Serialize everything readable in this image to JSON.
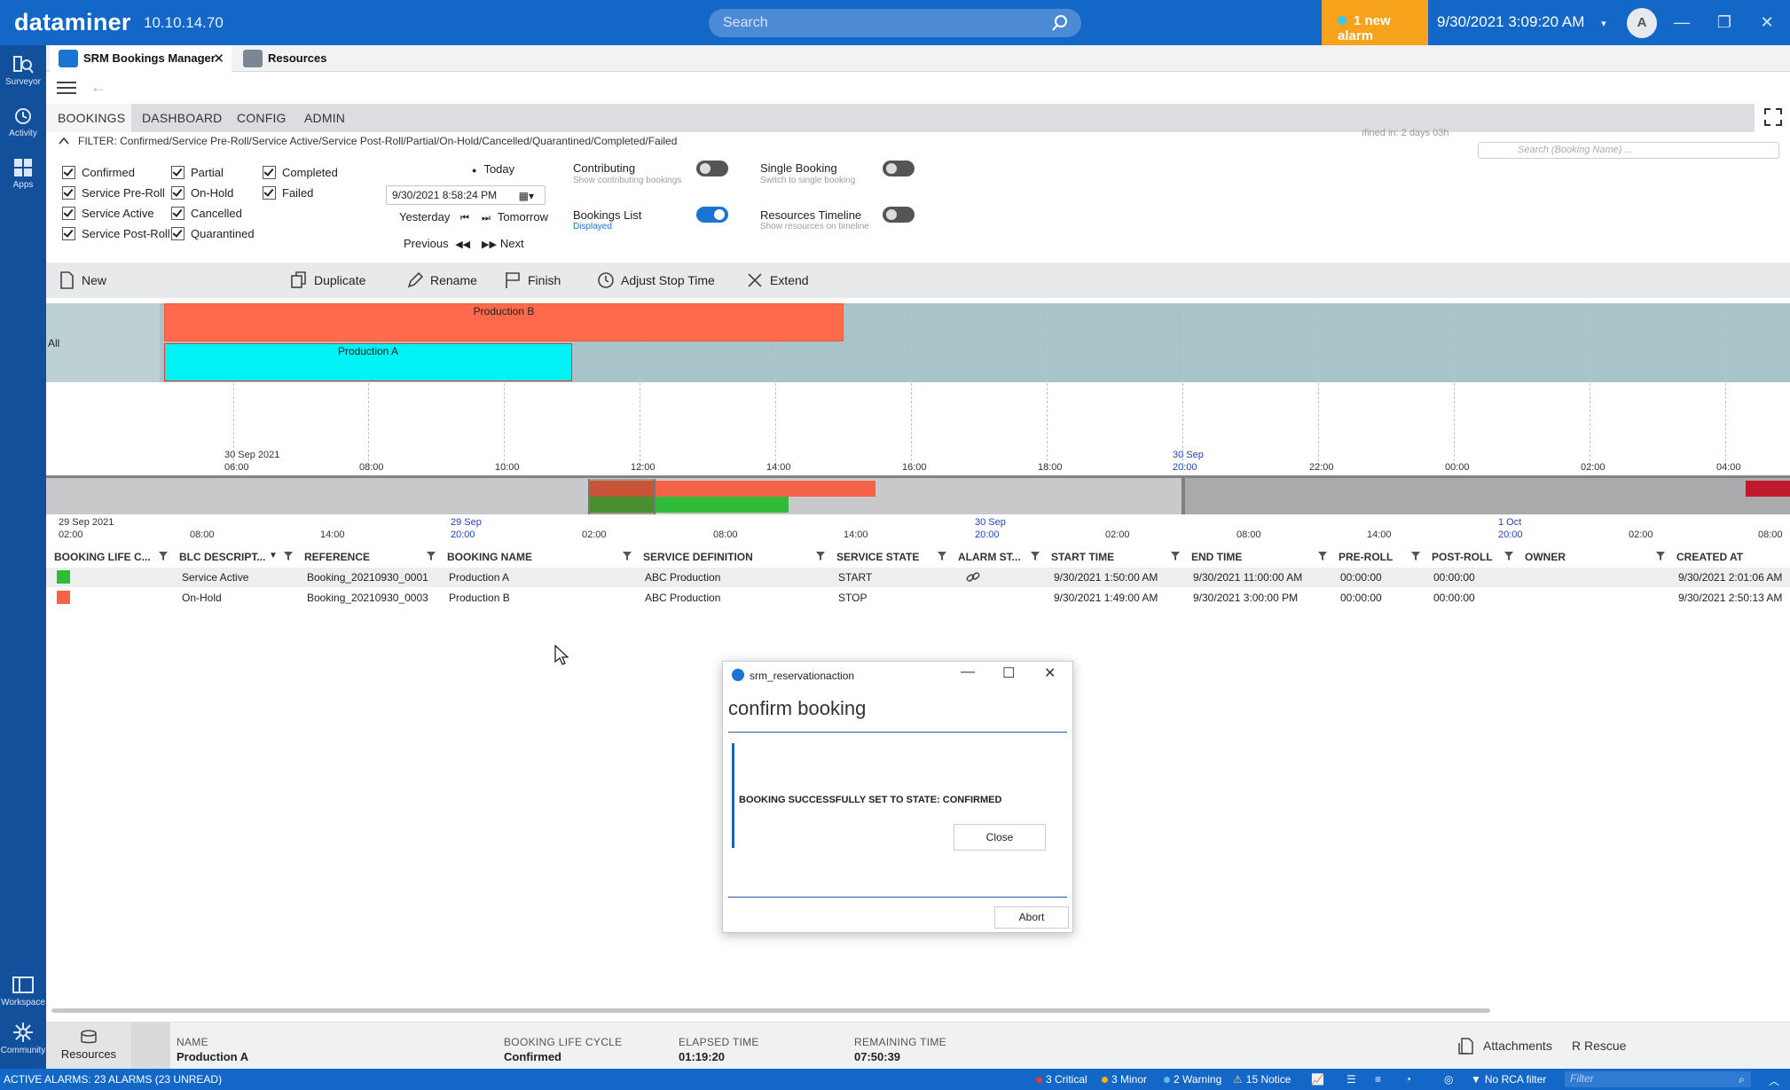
{
  "app": {
    "logo": "dataminer",
    "version": "10.10.14.70",
    "search_placeholder": "Search",
    "alarm_label": "1 new alarm",
    "datetime": "9/30/2021 3:09:20 AM",
    "avatar_initial": "A"
  },
  "rail": [
    {
      "label": "Surveyor",
      "icon": "surveyor-icon"
    },
    {
      "label": "Activity",
      "icon": "history-icon"
    },
    {
      "label": "Apps",
      "icon": "apps-grid-icon"
    },
    {
      "label": "Workspace",
      "icon": "workspace-icon"
    },
    {
      "label": "Community",
      "icon": "community-icon"
    }
  ],
  "tabs": [
    {
      "label": "SRM Bookings Manager",
      "active": true
    },
    {
      "label": "Resources",
      "active": false
    }
  ],
  "subtabs": [
    "BOOKINGS",
    "DASHBOARD",
    "CONFIG",
    "ADMIN"
  ],
  "filter_text": "FILTER: Confirmed/Service Pre-Roll/Service Active/Service Post-Roll/Partial/On-Hold/Cancelled/Quarantined/Completed/Failed",
  "defined_in": "ıfined in: 2 days 03h",
  "booking_search_placeholder": "Search (Booking Name) ...",
  "checkboxes": {
    "col1": [
      "Confirmed",
      "Service Pre-Roll",
      "Service Active",
      "Service Post-Roll"
    ],
    "col2": [
      "Partial",
      "On-Hold",
      "Cancelled",
      "Quarantined"
    ],
    "col3": [
      "Completed",
      "Failed"
    ]
  },
  "date_nav": {
    "today": "Today",
    "date_value": "9/30/2021 8:58:24 PM",
    "yesterday": "Yesterday",
    "tomorrow": "Tomorrow",
    "previous": "Previous",
    "next": "Next"
  },
  "toggles": {
    "contributing": {
      "label": "Contributing",
      "sub": "Show contributing bookings",
      "on": false
    },
    "bookings_list": {
      "label": "Bookings List",
      "sub": "Displayed",
      "on": true
    },
    "single_booking": {
      "label": "Single Booking",
      "sub": "Switch to single booking",
      "on": false
    },
    "resources_timeline": {
      "label": "Resources Timeline",
      "sub": "Show resources on timeline",
      "on": false
    }
  },
  "toolbar": {
    "new": "New",
    "duplicate": "Duplicate",
    "rename": "Rename",
    "finish": "Finish",
    "adjust": "Adjust Stop Time",
    "extend": "Extend"
  },
  "timeline": {
    "row_label": "All",
    "bars": [
      {
        "name": "Production B",
        "color": "#ff6a4d"
      },
      {
        "name": "Production A",
        "color": "#00f2f5"
      }
    ],
    "date_labels": [
      "30 Sep 2021",
      "30 Sep"
    ],
    "ticks": [
      "06:00",
      "08:00",
      "10:00",
      "12:00",
      "14:00",
      "16:00",
      "18:00",
      "20:00",
      "22:00",
      "00:00",
      "02:00",
      "04:00"
    ]
  },
  "overview": {
    "dates": [
      "29 Sep 2021",
      "29 Sep",
      "30 Sep",
      "1 Oct"
    ],
    "ticks": [
      "02:00",
      "08:00",
      "14:00",
      "20:00",
      "02:00",
      "08:00",
      "14:00",
      "20:00",
      "02:00",
      "08:00",
      "14:00",
      "20:00",
      "02:00",
      "08:00"
    ]
  },
  "table": {
    "headers": [
      "BOOKING LIFE C...",
      "BLC DESCRIPT...",
      "REFERENCE",
      "BOOKING NAME",
      "SERVICE DEFINITION",
      "SERVICE STATE",
      "ALARM ST...",
      "START TIME",
      "END TIME",
      "PRE-ROLL",
      "POST-ROLL",
      "OWNER",
      "CREATED AT"
    ],
    "rows": [
      {
        "color": "#2fbd39",
        "blc": "Service Active",
        "reference": "Booking_20210930_0001",
        "name": "Production A",
        "service_def": "ABC Production",
        "state": "START",
        "start": "9/30/2021 1:50:00 AM",
        "end": "9/30/2021 11:00:00 AM",
        "pre": "00:00:00",
        "post": "00:00:00",
        "owner": "",
        "created": "9/30/2021 2:01:06 AM"
      },
      {
        "color": "#f46248",
        "blc": "On-Hold",
        "reference": "Booking_20210930_0003",
        "name": "Production B",
        "service_def": "ABC Production",
        "state": "STOP",
        "start": "9/30/2021 1:49:00 AM",
        "end": "9/30/2021 3:00:00 PM",
        "pre": "00:00:00",
        "post": "00:00:00",
        "owner": "",
        "created": "9/30/2021 2:50:13 AM"
      }
    ]
  },
  "dialog": {
    "title": "srm_reservationaction",
    "heading": "confirm booking",
    "message": "BOOKING SUCCESSFULLY SET TO STATE: CONFIRMED",
    "close": "Close",
    "abort": "Abort"
  },
  "infobar": {
    "resources": "Resources",
    "name_key": "NAME",
    "name_val": "Production A",
    "blc_key": "BOOKING LIFE CYCLE",
    "blc_val": "Confirmed",
    "elapsed_key": "ELAPSED TIME",
    "elapsed_val": "01:19:20",
    "remaining_key": "REMAINING TIME",
    "remaining_val": "07:50:39",
    "attachments": "Attachments",
    "rescue": "R   Rescue"
  },
  "status": {
    "active_alarms": "ACTIVE ALARMS: 23 ALARMS (23 UNREAD)",
    "critical": "3 Critical",
    "minor": "3 Minor",
    "warning": "2 Warning",
    "notice": "15 Notice",
    "rca": "No RCA filter",
    "filter_placeholder": "Filter",
    "colors": {
      "critical": "#e53935",
      "minor": "#ffb300",
      "warning": "#64b5f6"
    }
  }
}
